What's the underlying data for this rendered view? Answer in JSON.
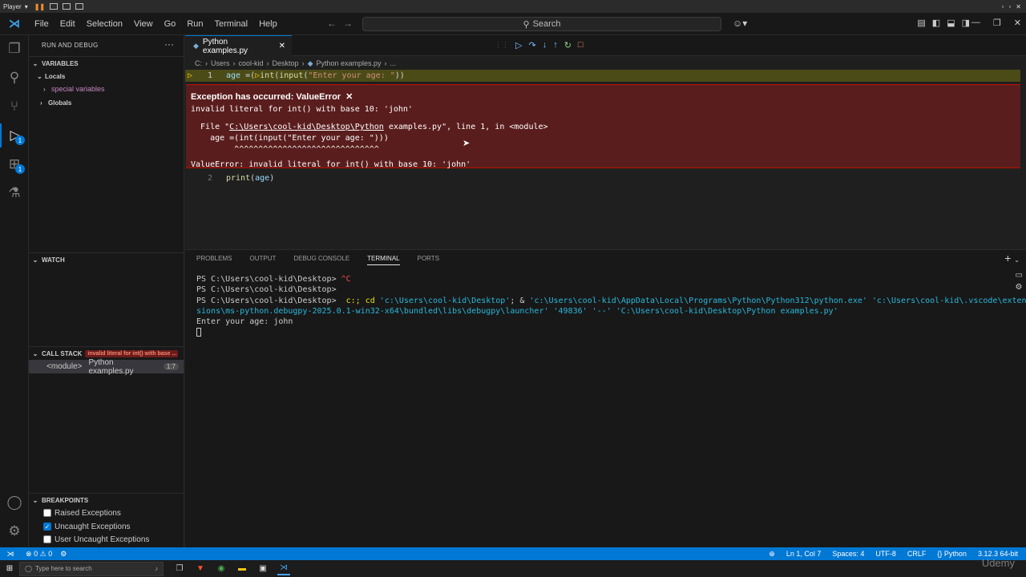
{
  "vm": {
    "player_label": "Player"
  },
  "titlebar": {
    "menu": [
      "File",
      "Edit",
      "Selection",
      "View",
      "Go",
      "Run",
      "Terminal",
      "Help"
    ],
    "search_label": "Search"
  },
  "activity_badges": {
    "run_debug": "1",
    "extensions": "1"
  },
  "sidebar": {
    "title": "RUN AND DEBUG",
    "variables": {
      "header": "VARIABLES",
      "locals": "Locals",
      "special": "special variables",
      "globals": "Globals"
    },
    "watch": {
      "header": "WATCH"
    },
    "call_stack": {
      "header": "CALL STACK",
      "error_badge": "invalid literal for int() with base ...",
      "frame_name": "<module>",
      "frame_file": "Python examples.py",
      "frame_line": "1:7"
    },
    "breakpoints": {
      "header": "BREAKPOINTS",
      "items": [
        {
          "label": "Raised Exceptions",
          "checked": false
        },
        {
          "label": "Uncaught Exceptions",
          "checked": true
        },
        {
          "label": "User Uncaught Exceptions",
          "checked": false
        }
      ]
    }
  },
  "editor": {
    "tab_label": "Python examples.py",
    "breadcrumb": [
      "C:",
      "Users",
      "cool-kid",
      "Desktop",
      "Python examples.py",
      "..."
    ],
    "line1": {
      "number": "1",
      "var": "age",
      "op": " =(",
      "fn1": "int",
      "p1": "(",
      "fn2": "input",
      "p2": "(",
      "str": "\"Enter your age: \"",
      "close": "))"
    },
    "exception": {
      "title": "Exception has occurred: ValueError",
      "message": "invalid literal for int() with base 10: 'john'",
      "trace_prefix": "  File \"",
      "trace_path": "C:\\Users\\cool-kid\\Desktop\\Python",
      "trace_suffix": " examples.py\", line 1, in <module>",
      "trace_code": "    age =(int(input(\"Enter your age: \")))",
      "trace_carets": "         ^^^^^^^^^^^^^^^^^^^^^^^^^^^^^^",
      "final": "ValueError: invalid literal for int() with base 10: 'john'"
    },
    "line2": {
      "number": "2",
      "fn": "print",
      "open": "(",
      "var": "age",
      "close": ")"
    }
  },
  "panel": {
    "tabs": [
      "PROBLEMS",
      "OUTPUT",
      "DEBUG CONSOLE",
      "TERMINAL",
      "PORTS"
    ],
    "active_tab": "TERMINAL",
    "terminal": {
      "line1_prompt": "PS C:\\Users\\cool-kid\\Desktop> ",
      "line1_ctrl": "^C",
      "line2_prompt": "PS C:\\Users\\cool-kid\\Desktop>",
      "line3_prompt": "PS C:\\Users\\cool-kid\\Desktop> ",
      "line3_cmd1": " c:; cd ",
      "line3_str1": "'c:\\Users\\cool-kid\\Desktop'",
      "line3_mid": "; & ",
      "line3_str2": "'c:\\Users\\cool-kid\\AppData\\Local\\Programs\\Python\\Python312\\python.exe' 'c:\\Users\\cool-kid\\.vscode\\exten",
      "line4": "sions\\ms-python.debugpy-2025.0.1-win32-x64\\bundled\\libs\\debugpy\\launcher' '49836' '--' 'C:\\Users\\cool-kid\\Desktop\\Python examples.py'",
      "line5": "Enter your age: john"
    }
  },
  "statusbar": {
    "errors": "0",
    "warnings": "0",
    "position": "Ln 1, Col 7",
    "spaces": "Spaces: 4",
    "encoding": "UTF-8",
    "eol": "CRLF",
    "language": "Python",
    "interpreter": "3.12.3 64-bit"
  },
  "taskbar": {
    "search_placeholder": "Type here to search"
  },
  "watermark": "Udemy",
  "colors": {
    "accent": "#0078d4",
    "exception_bg": "#5a1d1d",
    "current_line": "#4b4b18"
  }
}
